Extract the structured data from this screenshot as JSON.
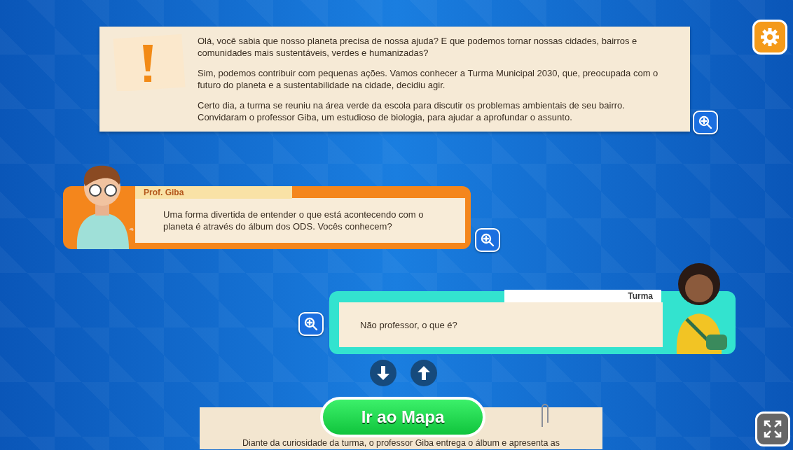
{
  "narration": {
    "paragraphs": [
      "Olá, você sabia que nosso planeta precisa de nossa ajuda? E que podemos tornar nossas cidades, bairros e comunidades mais sustentáveis, verdes e humanizadas?",
      "Sim, podemos contribuir com pequenas ações. Vamos conhecer a Turma Municipal 2030, que, preocupada com o futuro do planeta e a sustentabilidade na cidade, decidiu agir.",
      "Certo dia, a turma se reuniu na área verde da escola para discutir os problemas ambientais de seu bairro. Convidaram o professor Giba, um estudioso de biologia, para ajudar a aprofundar o assunto."
    ]
  },
  "dialogues": [
    {
      "kind": "left",
      "speaker": "Prof. Giba",
      "text": "Uma forma divertida de entender o que está acontecendo com o planeta é através do álbum dos ODS. Vocês conhecem?"
    },
    {
      "kind": "right",
      "speaker": "Turma",
      "text": "Não professor, o que é?"
    }
  ],
  "map_button": {
    "label": "Ir ao Mapa"
  },
  "next_narration": {
    "text": "Diante da curiosidade da turma, o professor Giba entrega o álbum e apresenta as"
  }
}
